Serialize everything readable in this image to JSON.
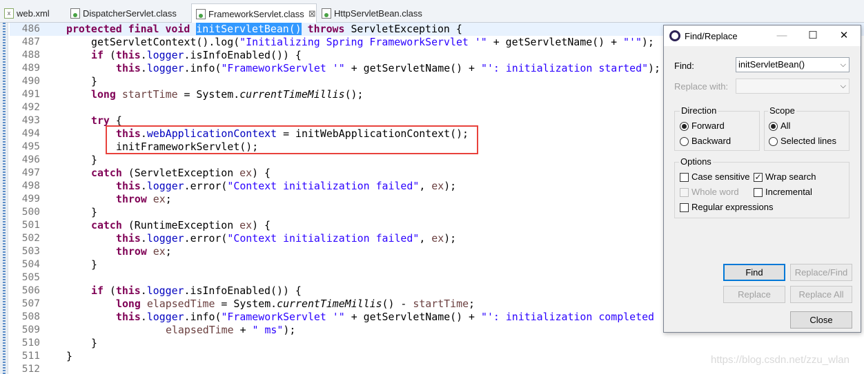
{
  "tabs": [
    {
      "label": "web.xml",
      "icon": "xml-file-icon"
    },
    {
      "label": "DispatcherServlet.class",
      "icon": "class-file-icon"
    },
    {
      "label": "FrameworkServlet.class",
      "icon": "class-file-icon",
      "active": true,
      "close": "⊠"
    },
    {
      "label": "HttpServletBean.class",
      "icon": "class-file-icon"
    }
  ],
  "editor": {
    "lines": [
      {
        "n": "486"
      },
      {
        "n": "487"
      },
      {
        "n": "488"
      },
      {
        "n": "489"
      },
      {
        "n": "490"
      },
      {
        "n": "491"
      },
      {
        "n": "492"
      },
      {
        "n": "493"
      },
      {
        "n": "494"
      },
      {
        "n": "495"
      },
      {
        "n": "496"
      },
      {
        "n": "497"
      },
      {
        "n": "498"
      },
      {
        "n": "499"
      },
      {
        "n": "500"
      },
      {
        "n": "501"
      },
      {
        "n": "502"
      },
      {
        "n": "503"
      },
      {
        "n": "504"
      },
      {
        "n": "505"
      },
      {
        "n": "506"
      },
      {
        "n": "507"
      },
      {
        "n": "508"
      },
      {
        "n": "509"
      },
      {
        "n": "510"
      },
      {
        "n": "511"
      },
      {
        "n": "512"
      }
    ],
    "code": {
      "kw_protected": "protected",
      "kw_final": "final",
      "kw_void": "void",
      "method_selected": "initServletBean()",
      "kw_throws": "throws",
      "t_servlet_exception": "ServletException {",
      "l487_a": "getServletContext().log(",
      "l487_str": "\"Initializing Spring FrameworkServlet '\"",
      "l487_b": " + getServletName() + ",
      "l487_str2": "\"'\"",
      "l487_c": ");",
      "kw_if": "if",
      "kw_this": "this",
      "f_logger": "logger",
      "l488_b": ".isInfoEnabled()) {",
      "l489_b": ".info(",
      "l489_str": "\"FrameworkServlet '\"",
      "l489_c": " + getServletName() + ",
      "l489_str2": "\"': initialization started\"",
      "l489_d": ");",
      "close_brace": "}",
      "kw_long": "long",
      "v_startTime": "startTime",
      "l491_eq": " = System.",
      "m_ctm": "currentTimeMillis",
      "l491_end": "();",
      "kw_try": "try",
      "open_brace": "{",
      "f_wac": "webApplicationContext",
      "l494_c": " = initWebApplicationContext();",
      "l495": "initFrameworkServlet();",
      "kw_catch": "catch",
      "l497_b": " (ServletException ",
      "v_ex": "ex",
      "l497_c": ") {",
      "l498_b": ".error(",
      "l498_str": "\"Context initialization failed\"",
      "l498_c": ", ",
      "l498_d": ");",
      "kw_throw": "throw",
      "l499_c": ";",
      "l501_b": " (RuntimeException ",
      "v_elapsed": "elapsedTime",
      "l507_b": "() - ",
      "l507_end": ";",
      "l508_str2": "\"': initialization completed",
      "l509_str": "\" ms\"",
      "l509_b": " + ",
      "l509_c": ");"
    },
    "watermark": "https://blog.csdn.net/zzu_wlan"
  },
  "dialog": {
    "title": "Find/Replace",
    "minimize": "—",
    "maximize": "☐",
    "close": "✕",
    "find_label": "Find:",
    "find_value": "initServletBean()",
    "replace_label": "Replace with:",
    "replace_value": "",
    "direction_title": "Direction",
    "forward": "Forward",
    "backward": "Backward",
    "scope_title": "Scope",
    "all": "All",
    "selected_lines": "Selected lines",
    "options_title": "Options",
    "case_sensitive": "Case sensitive",
    "wrap_search": "Wrap search",
    "whole_word": "Whole word",
    "incremental": "Incremental",
    "regular_expressions": "Regular expressions",
    "checkmark": "✓",
    "dropdown_arrow": "⌵",
    "btn_find": "Find",
    "btn_replace_find": "Replace/Find",
    "btn_replace": "Replace",
    "btn_replace_all": "Replace All",
    "btn_close": "Close"
  }
}
